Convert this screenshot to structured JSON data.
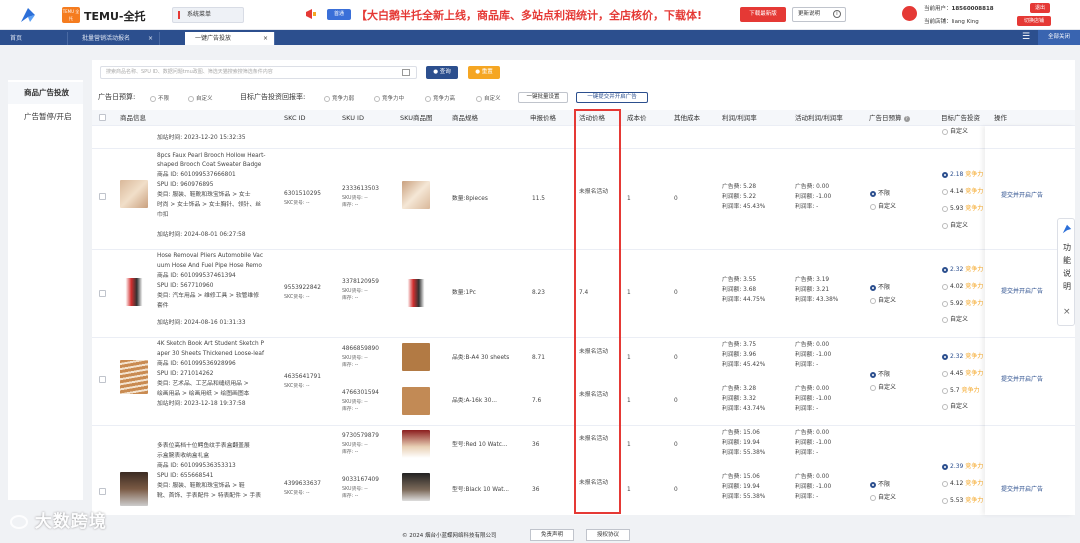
{
  "header": {
    "app_title": "TEMU-全托",
    "temu_badge": "TEMU 全托",
    "system_menu": "系统菜单",
    "promo_badge": "首通",
    "promo_text": "【大白鹅半托全新上线，商品库、多站点利润统计，全店核价，下载体!",
    "download_btn": "下载最新版",
    "notes_btn": "更新说明",
    "current_user_label": "当前用户：",
    "current_user": "18560008818",
    "logout": "退出",
    "current_shop_label": "当前店铺：",
    "current_shop": "liang King",
    "switch_shop": "切换店铺"
  },
  "tabs": [
    {
      "label": "首页"
    },
    {
      "label": "批量营销活动报名"
    },
    {
      "label": "一键广告投放"
    }
  ],
  "close_all": "全部关闭",
  "leftnav": {
    "items": [
      {
        "label": "商品广告投放"
      },
      {
        "label": "广告暂停/开启"
      }
    ]
  },
  "filters": {
    "search_placeholder": "搜索商品名称、SPU ID、数据问题tmu政图、筛选天猫搜索搜筛选条件内容",
    "query_btn": "查询",
    "reset_btn": "重置",
    "budget_label": "广告日预算:",
    "budget_opts": [
      "不限",
      "自定义"
    ],
    "roi_label": "目标广告投资回报率:",
    "roi_opts": [
      "竞争力弱",
      "竞争力中",
      "竞争力高",
      "自定义"
    ],
    "batch_btn": "一键批量设置",
    "submit_btn": "一键提交并开启广告"
  },
  "table": {
    "headers": [
      "商品信息",
      "SKC ID",
      "SKU ID",
      "SKU商品图",
      "商品规格",
      "申报价格",
      "活动价格",
      "成本价",
      "其他成本",
      "利润/利润率",
      "活动利润/利润率",
      "广告日预算",
      "目标广告投资",
      "操作"
    ],
    "top_partial": {
      "added": "加站时间: 2023-12-20 15:32:35",
      "bid_custom": "自定义"
    },
    "rows": [
      {
        "name1": "8pcs Faux Pearl Brooch Hollow Heart-",
        "name2": "shaped Brooch Coat Sweater Badge",
        "product_id": "商品 ID: 601099537666801",
        "spu": "SPU ID: 960976895",
        "cat1": "类目: 服装、鞋靴和珠宝饰品 > 女士",
        "cat2": "时尚 > 女士饰品 > 女士胸针、领针、丝",
        "cat3": "巾扣",
        "added": "加站时间: 2024-08-01 06:27:58",
        "skc": "6301510295",
        "skc_sub": "SKC货号: --",
        "skus": [
          {
            "id": "2333613503",
            "sub1": "SKU货号: --",
            "sub2": "库存: --",
            "spec": "数量:8pieces",
            "price": "11.5",
            "act": "未报名活动",
            "cost": "1",
            "other": "0",
            "p1": "广告费: 5.28",
            "p2": "利润额: 5.22",
            "p3": "利润率: 45.43%",
            "a1": "广告费: 0.00",
            "a2": "利润额: -1.00",
            "a3": "利润率: -"
          }
        ],
        "budget": [
          "不限",
          "自定义"
        ],
        "bids": [
          {
            "v": "2.18",
            "t": "竞争力"
          },
          {
            "v": "4.14",
            "t": "竞争力"
          },
          {
            "v": "5.93",
            "t": "竞争力"
          },
          {
            "v": "自定义",
            "t": ""
          }
        ],
        "op": "提交并开启广告"
      },
      {
        "name1": "Hose Removal Pliers Automobile Vac",
        "name2": "uum Hose And Fuel Pipe Hose Remo",
        "product_id": "商品 ID: 601099537461394",
        "spu": "SPU ID: 567710960",
        "cat1": "类目: 汽车用品 > 维修工具 > 软管维修",
        "cat2": "套件",
        "cat3": "",
        "added": "加站时间: 2024-08-16 01:31:33",
        "skc": "9553922842",
        "skc_sub": "SKC货号: --",
        "skus": [
          {
            "id": "3378120959",
            "sub1": "SKU货号: --",
            "sub2": "库存: --",
            "spec": "数量:1Pc",
            "price": "8.23",
            "act": "7.4",
            "cost": "1",
            "other": "0",
            "p1": "广告费: 3.55",
            "p2": "利润额: 3.68",
            "p3": "利润率: 44.75%",
            "a1": "广告费: 3.19",
            "a2": "利润额: 3.21",
            "a3": "利润率: 43.38%"
          }
        ],
        "budget": [
          "不限",
          "自定义"
        ],
        "bids": [
          {
            "v": "2.32",
            "t": "竞争力"
          },
          {
            "v": "4.02",
            "t": "竞争力"
          },
          {
            "v": "5.92",
            "t": "竞争力"
          },
          {
            "v": "自定义",
            "t": ""
          }
        ],
        "op": "提交并开启广告"
      },
      {
        "name1": "4K Sketch Book Art Student Sketch P",
        "name2": "aper 30 Sheets Thickened Loose-leaf",
        "product_id": "商品 ID: 601099536928996",
        "spu": "SPU ID: 271014262",
        "cat1": "类目: 艺术品、工艺品和缝纫用品 >",
        "cat2": "绘画用品 > 绘画用纸 > 绘图画图本",
        "cat3": "",
        "added": "加站时间: 2023-12-18 19:37:58",
        "skc": "4635641791",
        "skc_sub": "SKC货号: --",
        "skus": [
          {
            "id": "4866859890",
            "sub1": "SKU货号: --",
            "sub2": "库存: --",
            "spec": "品类:B-A4 30 sheets",
            "price": "8.71",
            "act": "未报名活动",
            "cost": "1",
            "other": "0",
            "p1": "广告费: 3.75",
            "p2": "利润额: 3.96",
            "p3": "利润率: 45.42%",
            "a1": "广告费: 0.00",
            "a2": "利润额: -1.00",
            "a3": "利润率: -"
          },
          {
            "id": "4766301594",
            "sub1": "SKU货号: --",
            "sub2": "库存: --",
            "spec": "品类:A-16k 30...",
            "price": "7.6",
            "act": "未报名活动",
            "cost": "1",
            "other": "0",
            "p1": "广告费: 3.28",
            "p2": "利润额: 3.32",
            "p3": "利润率: 43.74%",
            "a1": "广告费: 0.00",
            "a2": "利润额: -1.00",
            "a3": "利润率: -"
          }
        ],
        "budget": [
          "不限",
          "自定义"
        ],
        "bids": [
          {
            "v": "2.32",
            "t": "竞争力"
          },
          {
            "v": "4.45",
            "t": "竞争力"
          },
          {
            "v": "5.7",
            "t": "竞争力"
          },
          {
            "v": "自定义",
            "t": ""
          }
        ],
        "op": "提交并开启广告"
      },
      {
        "name1": "多表位高档十位鳄鱼纹手表盒翻盖展",
        "name2": "示盒腕表收纳盒礼盒",
        "product_id": "商品 ID: 601099536353313",
        "spu": "SPU ID: 655668541",
        "cat1": "类目: 服装、鞋靴和珠宝饰品 > 鞋",
        "cat2": "靴、首饰、手表配件 > 特表配件 > 手表",
        "cat3": "",
        "added": "",
        "skc": "4399633637",
        "skc_sub": "SKC货号: --",
        "skus": [
          {
            "id": "9730579879",
            "sub1": "SKU货号: --",
            "sub2": "库存: --",
            "spec": "型号:Red 10 Watc...",
            "price": "36",
            "act": "未报名活动",
            "cost": "1",
            "other": "0",
            "p1": "广告费: 15.06",
            "p2": "利润额: 19.94",
            "p3": "利润率: 55.38%",
            "a1": "广告费: 0.00",
            "a2": "利润额: -1.00",
            "a3": "利润率: -"
          },
          {
            "id": "9033167409",
            "sub1": "SKU货号: --",
            "sub2": "库存: --",
            "spec": "型号:Black 10 Wat...",
            "price": "36",
            "act": "未报名活动",
            "cost": "1",
            "other": "0",
            "p1": "广告费: 15.06",
            "p2": "利润额: 19.94",
            "p3": "利润率: 55.38%",
            "a1": "广告费: 0.00",
            "a2": "利润额: -1.00",
            "a3": "利润率: -"
          }
        ],
        "budget": [
          "不限",
          "自定义"
        ],
        "bids": [
          {
            "v": "2.39",
            "t": "竞争力"
          },
          {
            "v": "4.12",
            "t": "竞争力"
          },
          {
            "v": "5.53",
            "t": "竞争力"
          },
          {
            "v": "",
            "t": ""
          }
        ],
        "op": "提交并开启广告"
      }
    ]
  },
  "side_help": "功能说明",
  "footer": {
    "copyright": "© 2024 烟台小蓝蝶网络科技有限公司",
    "disclaimer": "免责声明",
    "license": "授权协议"
  },
  "watermark": "大数跨境",
  "colors": {
    "brand": "#2c4f8e",
    "accent": "#e53935",
    "warning": "#f5a623"
  }
}
